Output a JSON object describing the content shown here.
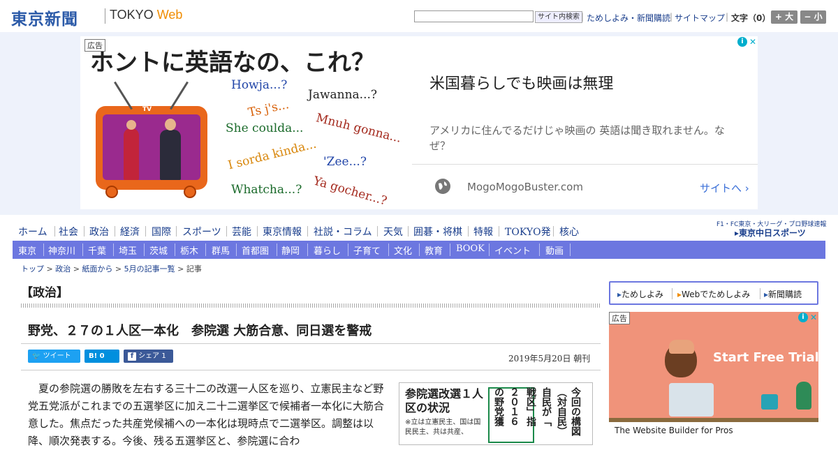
{
  "header": {
    "logo_jp": "東京新聞",
    "logo_en_prefix": "TOKYO ",
    "logo_en_suffix": "Web",
    "search_placeholder": "",
    "search_button": "サイト内検索",
    "links": [
      "ためしよみ・新聞購読",
      "サイトマップ"
    ],
    "font_size_label": "文字（0）",
    "font_larger": "+ 大",
    "font_smaller": "− 小"
  },
  "top_ad": {
    "ad_label": "広告",
    "image_headline": "ホントに英語なの、これ？",
    "tv_label": "TV",
    "phrases": [
      "Howja...?",
      "Jawanna...?",
      "Ts j's...",
      "She coulda...",
      "Mnuh gonna...",
      "I sorda kinda...",
      "'Zee...?",
      "Whatcha...?",
      "Ya gocher...?"
    ],
    "title": "米国暮らしでも映画は無理",
    "body": "アメリカに住んでるだけじゃ映画の 英語は聞き取れません。なぜ？",
    "domain": "MogoMogoBuster.com",
    "site_link": "サイトへ",
    "adchoices_i": "i",
    "adchoices_x": "✕"
  },
  "nav_primary": [
    "ホーム",
    "社会",
    "政治",
    "経済",
    "国際",
    "スポーツ",
    "芸能",
    "東京情報",
    "社説・コラム",
    "天気",
    "囲碁・将棋",
    "特報",
    "TOKYO発",
    "核心"
  ],
  "chunichi": {
    "sub": "F1・FC東京・大リーグ・プロ野球速報",
    "logo": "東京中日スポーツ"
  },
  "nav_regional": [
    "東京",
    "神奈川",
    "千葉",
    "埼玉",
    "茨城",
    "栃木",
    "群馬",
    "首都圏",
    "静岡",
    "暮らし",
    "子育て",
    "文化",
    "教育",
    "BOOK",
    "イベント",
    "動画"
  ],
  "breadcrumb": [
    "トップ",
    "政治",
    "紙面から",
    "5月の記事一覧",
    "記事"
  ],
  "article": {
    "section": "【政治】",
    "title": "野党、２７の１人区一本化　参院選 大筋合意、同日選を警戒",
    "share": {
      "tweet": "ツイート",
      "hatena": "B! 0",
      "facebook": "シェア 1"
    },
    "date": "2019年5月20日 朝刊",
    "body": "　夏の参院選の勝敗を左右する三十二の改選一人区を巡り、立憲民主など野党五党派がこれまでの五選挙区に加え二十二選挙区で候補者一本化に大筋合意した。焦点だった共産党候補への一本化は現時点で二選挙区。調整は以降、順次発表する。今後、残る五選挙区と、参院選に合わ"
  },
  "infographic": {
    "title": "参院選改選１人区の状況",
    "note": "※立は立憲民主、国は国民民主、共は共産、",
    "columns": [
      "今回の構図",
      "（対自民）",
      "自民が「",
      "戦区」指",
      "２０１６",
      "の野党獲"
    ]
  },
  "sidebar": {
    "links": [
      "ためしよみ",
      "Webでためしよみ",
      "新聞購読"
    ],
    "ad_label": "広告",
    "ad_cta": "Start Free Trial",
    "ad_caption": "The Website Builder for Pros",
    "ad_brand_color": "#f0937a"
  }
}
